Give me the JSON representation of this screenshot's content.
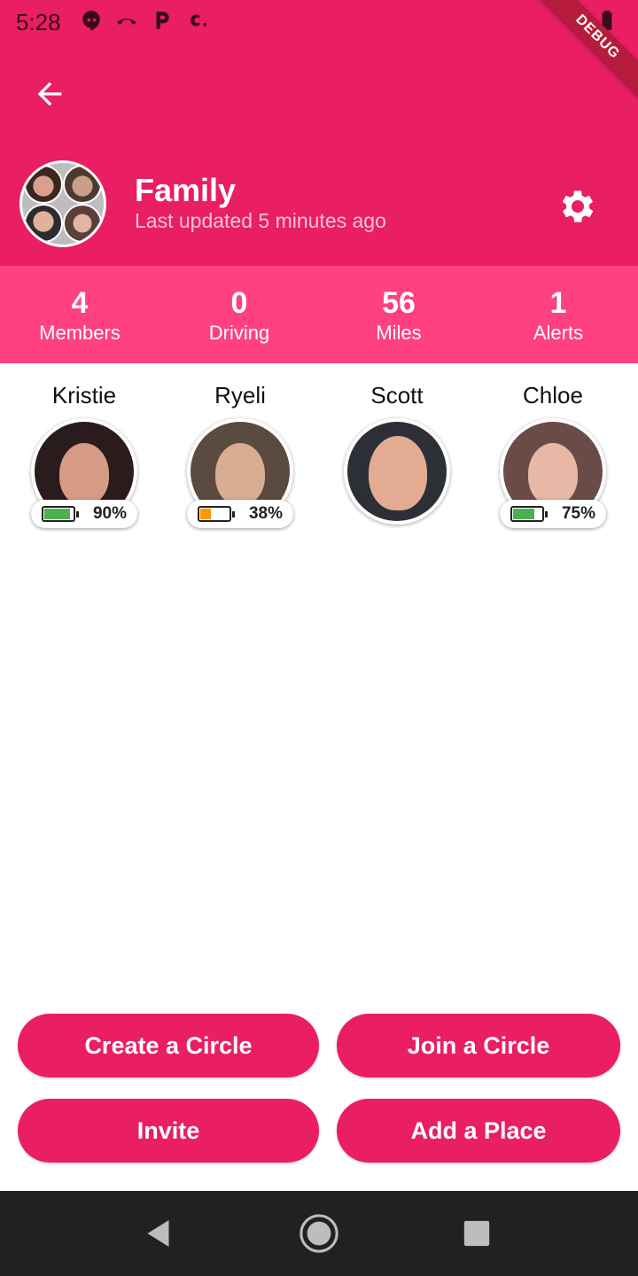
{
  "status_bar": {
    "time": "5:28"
  },
  "debug_label": "DEBUG",
  "colors": {
    "primary": "#e91e63",
    "accent": "#ff4081",
    "battery_high": "#4caf50",
    "battery_low": "#ff9800"
  },
  "header": {
    "back_icon": "arrow-left-icon",
    "circle_name": "Family",
    "last_updated": "Last updated 5 minutes ago",
    "settings_icon": "gear-icon"
  },
  "stats": [
    {
      "value": "4",
      "label": "Members"
    },
    {
      "value": "0",
      "label": "Driving"
    },
    {
      "value": "56",
      "label": "Miles"
    },
    {
      "value": "1",
      "label": "Alerts"
    }
  ],
  "members": [
    {
      "name": "Kristie",
      "battery": "90%",
      "battery_level": 0.9
    },
    {
      "name": "Ryeli",
      "battery": "38%",
      "battery_level": 0.38
    },
    {
      "name": "Scott",
      "battery": null,
      "battery_level": null
    },
    {
      "name": "Chloe",
      "battery": "75%",
      "battery_level": 0.75
    }
  ],
  "actions": {
    "create_circle": "Create a Circle",
    "join_circle": "Join a Circle",
    "invite": "Invite",
    "add_place": "Add a Place"
  }
}
